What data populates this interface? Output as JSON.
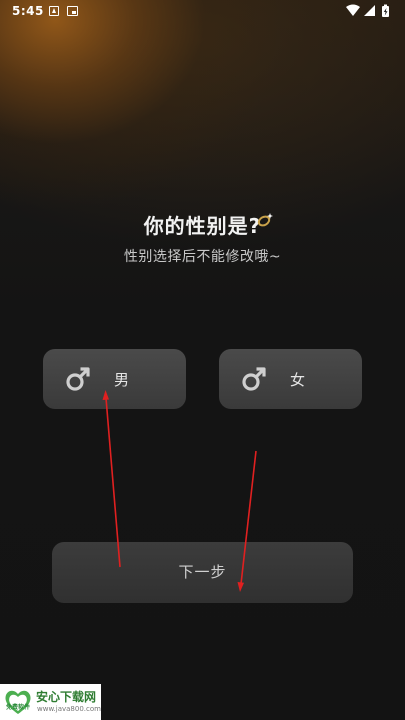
{
  "status_bar": {
    "time": "5:45",
    "icons": [
      "text-a-notification-icon",
      "picture-notification-icon",
      "wifi-icon",
      "signal-icon",
      "battery-charging-icon"
    ]
  },
  "header": {
    "title": "你的性别是?",
    "subtitle": "性别选择后不能修改哦~"
  },
  "gender_options": [
    {
      "label": "男",
      "icon": "male-symbol-icon"
    },
    {
      "label": "女",
      "icon": "male-symbol-icon"
    }
  ],
  "next_button": {
    "label": "下一步"
  },
  "annotation": {
    "arrow_color": "#e02020"
  },
  "watermark": {
    "name": "安心下载网",
    "url": "www.java800.com",
    "logo_text": "免费软件"
  },
  "colors": {
    "accent_gold": "#c9a24a",
    "card_bg": "#444444",
    "button_bg": "#363636"
  }
}
